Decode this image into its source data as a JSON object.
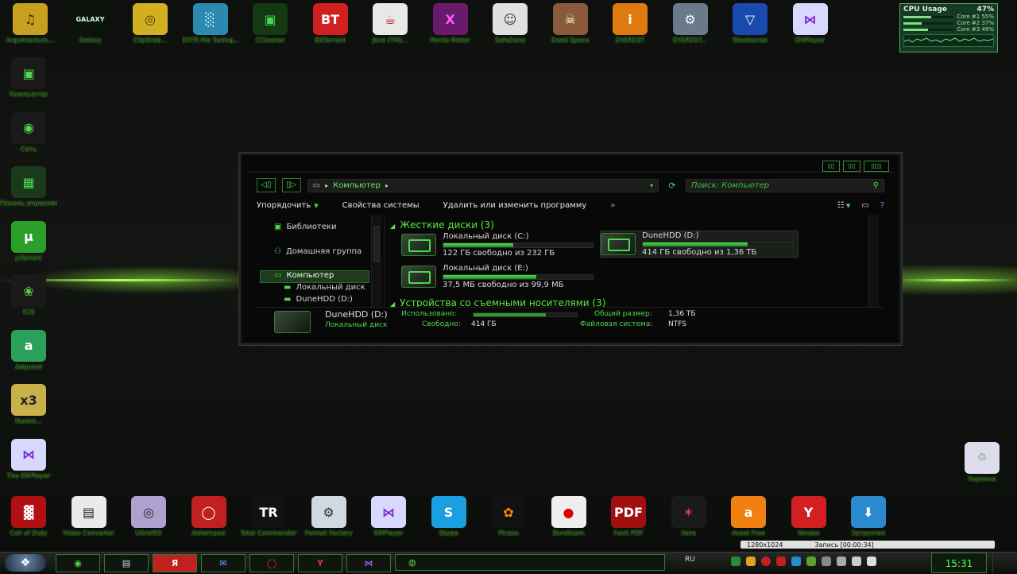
{
  "desktop_icons_top": [
    {
      "name": "Argumentum...",
      "char": "♫",
      "bg": "#c8a020",
      "color": "#3a2a00"
    },
    {
      "name": "Galaxy",
      "char": "GALAXY",
      "bg": "#0a140a",
      "color": "#dfe"
    },
    {
      "name": "ClipGrab...",
      "char": "◎",
      "bg": "#d0b020",
      "color": "#4a3a00"
    },
    {
      "name": "DXTR Me Tuning...",
      "char": "░",
      "bg": "#2a8ab0",
      "color": "#fff"
    },
    {
      "name": "CCleaner",
      "char": "▣",
      "bg": "#143a14",
      "color": "#4ed84e"
    },
    {
      "name": "BitTorrent",
      "char": "BT",
      "bg": "#d02020",
      "color": "#fff"
    },
    {
      "name": "Java (TM)...",
      "char": "☕",
      "bg": "#e8e8e8",
      "color": "#c00"
    },
    {
      "name": "Movie Maker",
      "char": "X",
      "bg": "#6a1a6a",
      "color": "#f5f"
    },
    {
      "name": "SafeZone",
      "char": "☺",
      "bg": "#e0e0e0",
      "color": "#333"
    },
    {
      "name": "Dead Space",
      "char": "☠",
      "bg": "#8a5a3a",
      "color": "#ffd"
    },
    {
      "name": "EVEREST",
      "char": "i",
      "bg": "#e07a10",
      "color": "#fff"
    },
    {
      "name": "EVEREST...",
      "char": "⚙",
      "bg": "#6a7a8a",
      "color": "#fff"
    },
    {
      "name": "Steelseries",
      "char": "▽",
      "bg": "#1a4ab0",
      "color": "#fff"
    },
    {
      "name": "KMPlayer",
      "char": "⋈",
      "bg": "#d8d8ff",
      "color": "#7a2ad0"
    }
  ],
  "desktop_icons_left": [
    {
      "name": "Компьютер",
      "char": "▣",
      "bg": "#1a1a1a",
      "color": "#4ed84e"
    },
    {
      "name": "Сеть",
      "char": "◉",
      "bg": "#1a1a1a",
      "color": "#4ed84e"
    },
    {
      "name": "Панель управления",
      "char": "▦",
      "bg": "#1a3a1a",
      "color": "#4ed84e"
    },
    {
      "name": "µTorrent",
      "char": "µ",
      "bg": "#2aa02a",
      "color": "#fff"
    },
    {
      "name": "ICQ",
      "char": "❀",
      "bg": "#1a1a1a",
      "color": "#5ad03a"
    },
    {
      "name": "Adguard",
      "char": "a",
      "bg": "#2aa05a",
      "color": "#fff"
    },
    {
      "name": "Вызов...",
      "char": "x3",
      "bg": "#c8b04a",
      "color": "#222"
    },
    {
      "name": "The KMPlayer",
      "char": "⋈",
      "bg": "#d8d8ff",
      "color": "#7a2ad0"
    }
  ],
  "desktop_icons_bottom": [
    {
      "name": "Call of Duty",
      "char": "▓",
      "bg": "#b01010",
      "color": "#fff"
    },
    {
      "name": "Video Converter",
      "char": "▤",
      "bg": "#eaeaea",
      "color": "#222"
    },
    {
      "name": "UltraISO",
      "char": "◎",
      "bg": "#b0a0d0",
      "color": "#222"
    },
    {
      "name": "Ashampoo",
      "char": "◯",
      "bg": "#c02020",
      "color": "#fff"
    },
    {
      "name": "Total Commander",
      "char": "TR",
      "bg": "#111",
      "color": "#fff"
    },
    {
      "name": "Format Factory",
      "char": "⚙",
      "bg": "#d0d8e0",
      "color": "#333"
    },
    {
      "name": "KMPlayer",
      "char": "⋈",
      "bg": "#d8d8ff",
      "color": "#7a2ad0"
    },
    {
      "name": "Skype",
      "char": "S",
      "bg": "#1aa0e0",
      "color": "#fff"
    },
    {
      "name": "Picasa",
      "char": "✿",
      "bg": "#111",
      "color": "#f80"
    },
    {
      "name": "Bandicam",
      "char": "●",
      "bg": "#eee",
      "color": "#d00"
    },
    {
      "name": "Foxit PDF",
      "char": "PDF",
      "bg": "#a01010",
      "color": "#fff"
    },
    {
      "name": "Xara",
      "char": "✶",
      "bg": "#1a1a1a",
      "color": "#e04040"
    },
    {
      "name": "Avast Free",
      "char": "a",
      "bg": "#f08010",
      "color": "#fff"
    },
    {
      "name": "Yandex",
      "char": "Y",
      "bg": "#d02020",
      "color": "#fff"
    },
    {
      "name": "Загрузчик",
      "char": "⬇",
      "bg": "#2a8ad0",
      "color": "#fff"
    }
  ],
  "recycle_bin": {
    "name": "Корзина",
    "char": "♲",
    "bg": "#dde",
    "color": "#2a8a2a"
  },
  "cpu_widget": {
    "title": "CPU Usage",
    "total": "47%",
    "cores": [
      {
        "label": "Core #1",
        "value": "55%",
        "fill": 0.55
      },
      {
        "label": "Core #2",
        "value": "37%",
        "fill": 0.37
      },
      {
        "label": "Core #3",
        "value": "49%",
        "fill": 0.49
      }
    ]
  },
  "explorer": {
    "address": "Компьютер",
    "search_placeholder": "Поиск: Компьютер",
    "commands": {
      "organize": "Упорядочить",
      "system_props": "Свойства системы",
      "uninstall": "Удалить или изменить программу",
      "more": "»"
    },
    "nav": {
      "libraries": "Библиотеки",
      "homegroup": "Домашняя группа",
      "computer": "Компьютер",
      "local_disk": "Локальный диск",
      "dunehdd": "DuneHDD (D:)"
    },
    "group_hdd": "Жесткие диски (3)",
    "group_removable": "Устройства со съемными носителями (3)",
    "drives": [
      {
        "name": "Локальный диск (C:)",
        "free": "122 ГБ свободно из 232 ГБ",
        "used_fraction": 0.47
      },
      {
        "name": "DuneHDD (D:)",
        "free": "414 ГБ свободно из 1,36 ТБ",
        "used_fraction": 0.7
      },
      {
        "name": "Локальный диск (E:)",
        "free": "37,5 МБ свободно из 99,9 МБ",
        "used_fraction": 0.62
      }
    ],
    "details": {
      "name": "DuneHDD (D:)",
      "type": "Локальный диск",
      "used_label": "Использовано:",
      "used_fraction": 0.7,
      "free_label": "Свободно:",
      "free_value": "414 ГБ",
      "total_label": "Общий размер:",
      "total_value": "1,36 ТБ",
      "fs_label": "Файловая система:",
      "fs_value": "NTFS"
    }
  },
  "taskbar": {
    "language": "RU",
    "clock": "15:31",
    "recording": {
      "resolution": "1280x1024",
      "label": "Запись [00:00:34]"
    }
  },
  "colors": {
    "accent": "#4ed84e",
    "background": "#0c0e0c"
  }
}
